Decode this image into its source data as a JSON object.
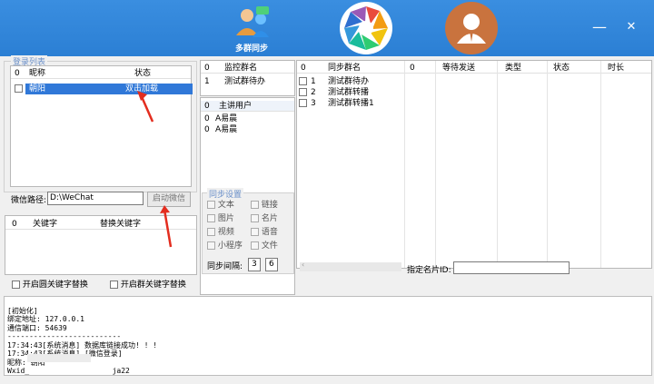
{
  "header": {
    "tab_label": "多群同步",
    "minimize": "—",
    "close": "✕",
    "accent": "#2b7fd4"
  },
  "login_list": {
    "title": "登录列表",
    "columns": [
      "0",
      "昵称",
      "状态"
    ],
    "rows": [
      {
        "nickname": "朝阳",
        "status": "双击加载"
      }
    ]
  },
  "wechat": {
    "path_label": "微信路径:",
    "path_value": "D:\\WeChat",
    "start_button": "启动微信"
  },
  "keywords": {
    "columns": [
      "0",
      "关键字",
      "替换关键字"
    ],
    "private_replace": "开启圆关键字替换",
    "group_replace": "开启群关键字替换"
  },
  "monitor": {
    "columns": [
      "0",
      "监控群名"
    ],
    "rows": [
      {
        "idx": "1",
        "name": "测试群待办"
      }
    ]
  },
  "speakers": {
    "columns": [
      "0",
      "主讲用户"
    ],
    "rows": [
      {
        "idx": "0",
        "name": "A易晨"
      },
      {
        "idx": "0",
        "name": "A易晨"
      }
    ]
  },
  "sync_groups": {
    "columns": [
      "0",
      "同步群名",
      "0",
      "等待发送",
      "类型",
      "状态",
      "时长"
    ],
    "rows": [
      {
        "idx": "1",
        "name": "测试群待办"
      },
      {
        "idx": "2",
        "name": "测试群转播"
      },
      {
        "idx": "3",
        "name": "测试群转播1"
      }
    ]
  },
  "sync_settings": {
    "title": "同步设置",
    "options": [
      "文本",
      "链接",
      "图片",
      "名片",
      "视频",
      "语音",
      "小程序",
      "文件"
    ],
    "interval_label": "同步间隔:",
    "interval_from": "3",
    "interval_to": "6",
    "card_id_label": "指定名片ID:"
  },
  "log": {
    "lines": [
      "[初始化]",
      "绑定地址: 127.0.0.1",
      "通信端口: 54639",
      "--------------------------",
      "17:34:43[系统消息] 数据库链接成功! ! !",
      "17:34:43[系统消息] [微信登录]",
      "昵称: 朝阳",
      "Wxid_                   ja22"
    ]
  }
}
